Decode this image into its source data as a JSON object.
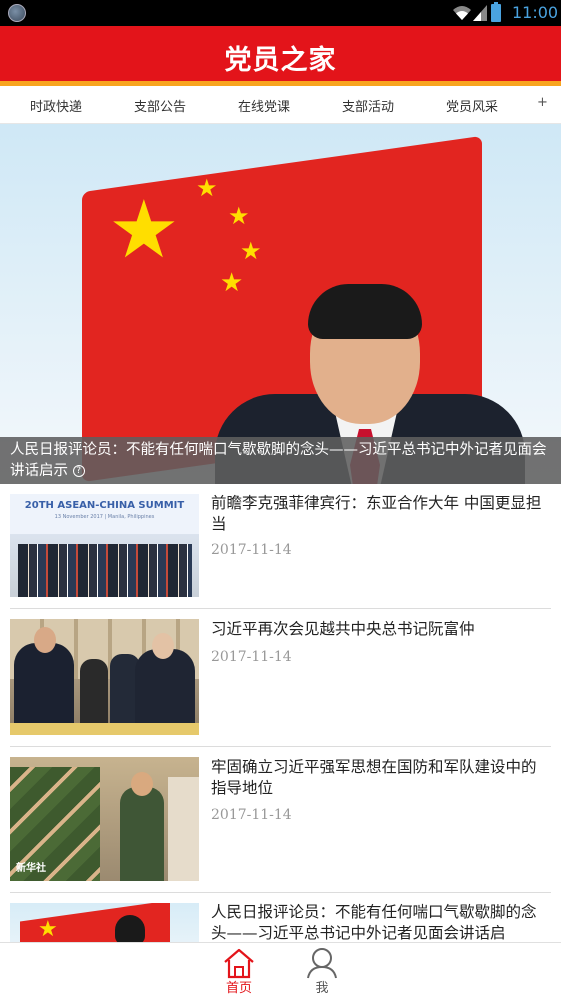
{
  "status_bar": {
    "time": "11:00"
  },
  "header": {
    "title": "党员之家"
  },
  "tabs": [
    {
      "label": "时政快递"
    },
    {
      "label": "支部公告"
    },
    {
      "label": "在线党课"
    },
    {
      "label": "支部活动"
    },
    {
      "label": "党员风采"
    }
  ],
  "tabs_more": "+",
  "banner": {
    "caption": "人民日报评论员：不能有任何喘口气歇歇脚的念头——习近平总书记中外记者见面会讲话启示",
    "help_glyph": "?"
  },
  "thumbnail_texts": {
    "summit_title": "20TH ASEAN-CHINA SUMMIT",
    "summit_sub": "13 November 2017 | Manila, Philippines",
    "watermark": "新华社"
  },
  "news": [
    {
      "title": "前瞻李克强菲律宾行：东亚合作大年 中国更显担当",
      "date": "2017-11-14"
    },
    {
      "title": "习近平再次会见越共中央总书记阮富仲",
      "date": "2017-11-14"
    },
    {
      "title": "牢固确立习近平强军思想在国防和军队建设中的指导地位",
      "date": "2017-11-14"
    },
    {
      "title": "人民日报评论员：不能有任何喘口气歇歇脚的念头——习近平总书记中外记者见面会讲话启",
      "date": ""
    }
  ],
  "bottom_nav": {
    "home_label": "首页",
    "me_label": "我"
  },
  "colors": {
    "brand_red": "#e3141a",
    "accent_orange": "#f8a51f",
    "nav_active": "#e3141a",
    "nav_inactive": "#555555"
  },
  "icons": {
    "home": "home-icon",
    "me": "person-icon",
    "wifi": "wifi-icon",
    "signal": "signal-icon",
    "battery": "battery-icon"
  }
}
